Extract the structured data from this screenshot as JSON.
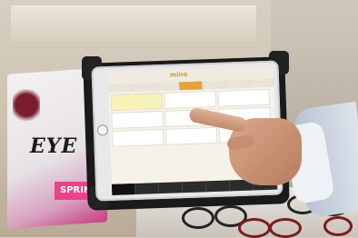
{
  "poster": {
    "brand": "EYE",
    "tag": "SPRING"
  },
  "tablet": {
    "logo": "mino",
    "header_right": "",
    "tabs": [
      "",
      "",
      "",
      "",
      "",
      "",
      ""
    ],
    "active_tab_index": 3,
    "cells": [
      "",
      "",
      "",
      "",
      "",
      "",
      "",
      "",
      ""
    ],
    "bottom_bar": [
      "",
      "",
      "",
      "",
      "",
      "",
      ""
    ]
  }
}
